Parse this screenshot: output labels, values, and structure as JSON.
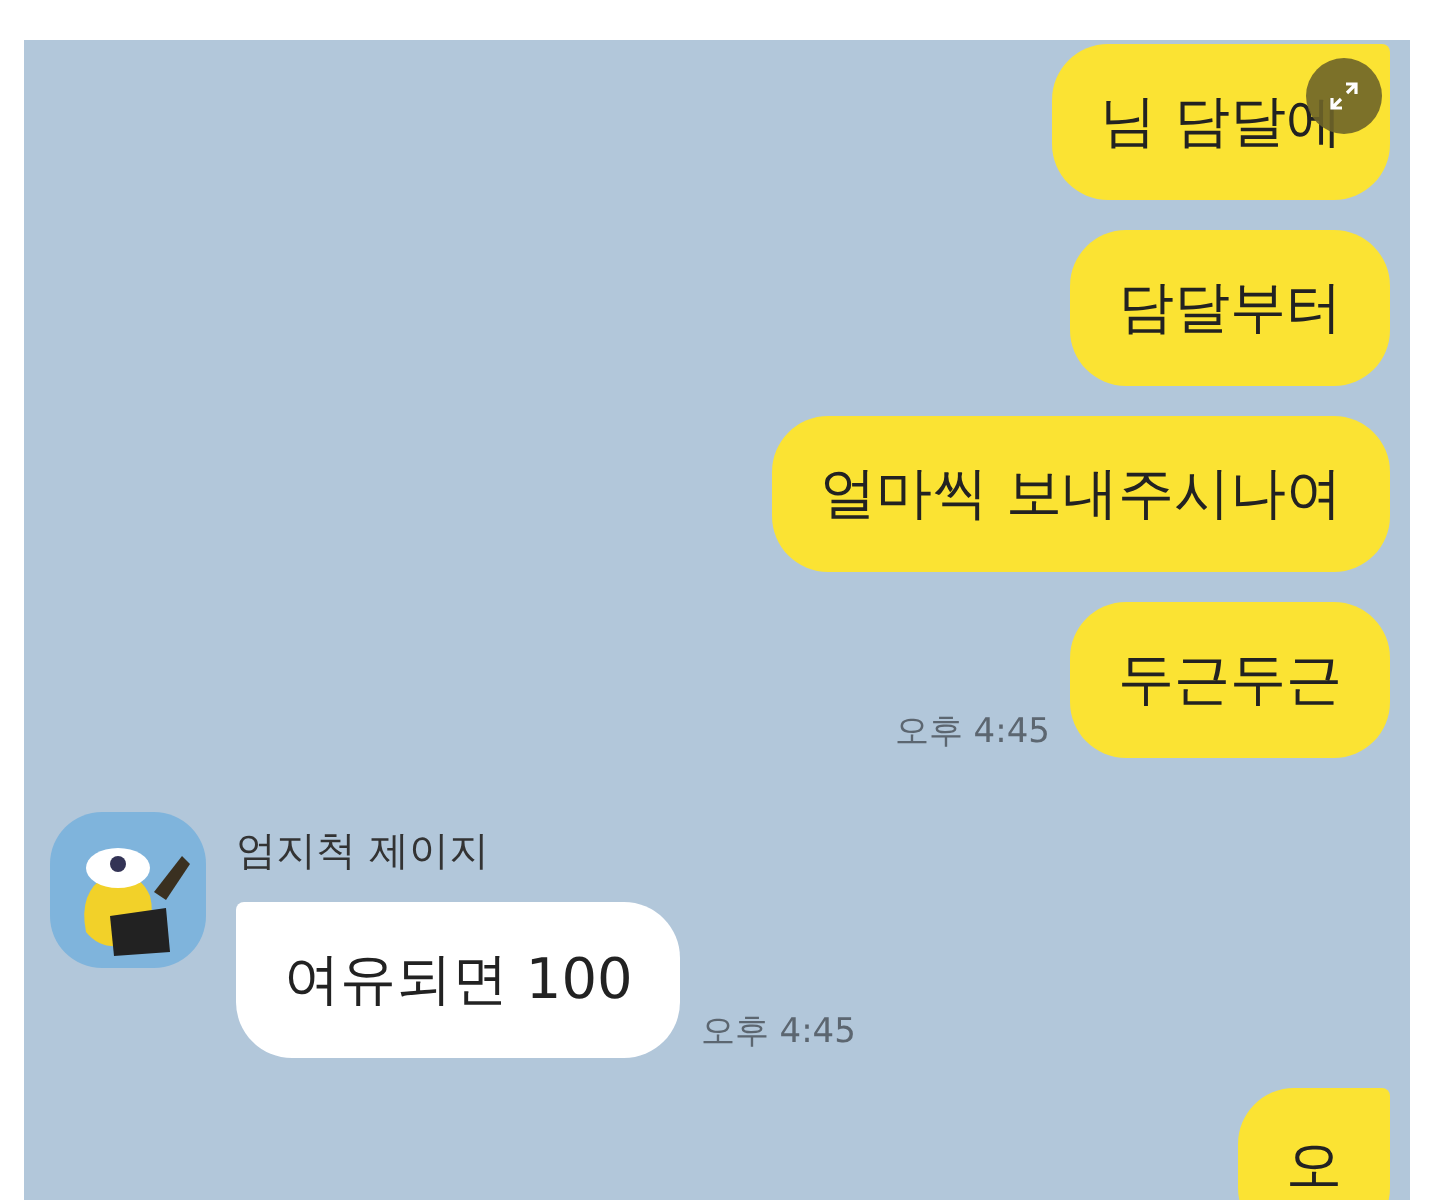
{
  "overlay": {
    "expand_button": true
  },
  "messages": [
    {
      "kind": "sent",
      "text": "님 담달에",
      "tail": true
    },
    {
      "kind": "sent",
      "text": "담달부터",
      "tail": false
    },
    {
      "kind": "sent",
      "text": "얼마씩 보내주시나여",
      "tail": false
    },
    {
      "kind": "sent",
      "text": "두근두근",
      "tail": false,
      "time": "오후 4:45"
    },
    {
      "kind": "received",
      "sender": "엄지척 제이지",
      "text": "여유되면 100",
      "tail": true,
      "time": "오후 4:45"
    },
    {
      "kind": "sent",
      "text": "오",
      "tail": true
    }
  ]
}
